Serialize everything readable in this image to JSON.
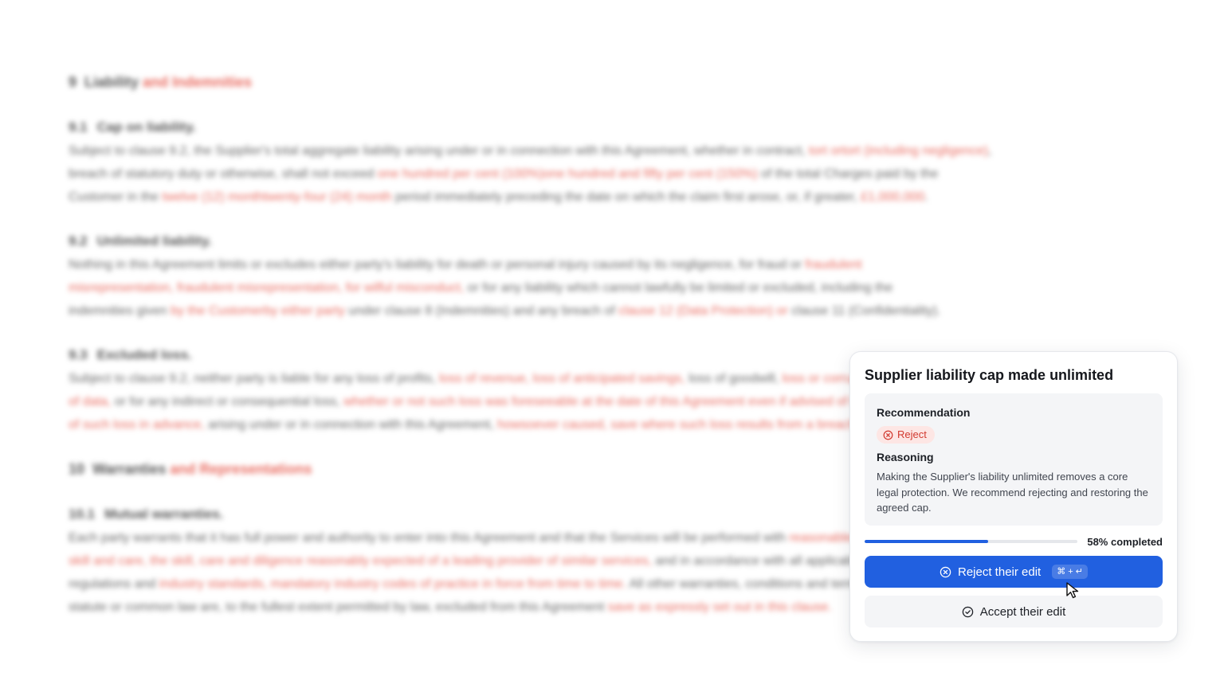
{
  "document": {
    "sections": [
      {
        "num": "9",
        "title": "Liability",
        "title_insert": "and Indemnities",
        "clauses": [
          {
            "num": "9.1",
            "title": "Cap on liability.",
            "lines": [
              [
                {
                  "t": "Subject to clause 9.2, the Supplier's total aggregate liability arising under or in connection with this Agreement, whether in contract, "
                },
                {
                  "t": "tort ortort (including negligence)",
                  "red": true
                },
                {
                  "t": ","
                }
              ],
              [
                {
                  "t": "breach of statutory duty or otherwise, shall not exceed "
                },
                {
                  "t": "one hundred per cent (100%)one hundred and fifty per cent (150%)",
                  "red": true
                },
                {
                  "t": " of the total Charges paid by the"
                }
              ],
              [
                {
                  "t": "Customer in the "
                },
                {
                  "t": "twelve (12) monthtwenty-four (24) month",
                  "red": true
                },
                {
                  "t": " period immediately preceding the date on which the claim first arose, or, if greater, "
                },
                {
                  "t": "£1,000,000",
                  "red": true
                },
                {
                  "t": "."
                }
              ]
            ]
          },
          {
            "num": "9.2",
            "title": "Unlimited liability.",
            "lines": [
              [
                {
                  "t": "Nothing in this Agreement limits or excludes either party's liability for death or personal injury caused by its negligence, for fraud or "
                },
                {
                  "t": "fraudulent",
                  "red": true
                }
              ],
              [
                {
                  "t": "misrepresentation, fraudulent misrepresentation, for wilful misconduct,",
                  "red": true
                },
                {
                  "t": " or for any liability which cannot lawfully be limited or excluded, including the"
                }
              ],
              [
                {
                  "t": "indemnities given "
                },
                {
                  "t": "by the Customerby either party",
                  "red": true
                },
                {
                  "t": " under clause 8 (Indemnities) and any breach of "
                },
                {
                  "t": "clause 12 (Data Protection) or",
                  "red": true
                },
                {
                  "t": " clause 11 (Confidentiality)."
                }
              ]
            ]
          },
          {
            "num": "9.3",
            "title": "Excluded loss.",
            "lines": [
              [
                {
                  "t": "Subject to clause 9.2, neither party is liable for any loss of profits, "
                },
                {
                  "t": "loss of revenue, loss of anticipated savings,",
                  "red": true
                },
                {
                  "t": " loss of goodwill, "
                },
                {
                  "t": "loss or corruption",
                  "red": true
                }
              ],
              [
                {
                  "t": "of data,",
                  "red": true
                },
                {
                  "t": " or for any indirect or consequential loss, "
                },
                {
                  "t": "whether or not such loss was foreseeable at the date of this Agreement even if advised of the possibility",
                  "red": true
                }
              ],
              [
                {
                  "t": "of such loss in advance,",
                  "red": true
                },
                {
                  "t": " arising under or in connection with this Agreement, "
                },
                {
                  "t": "howsoever caused, save where such loss results from a breach",
                  "red": true
                }
              ]
            ]
          }
        ]
      },
      {
        "num": "10",
        "title": "Warranties",
        "title_insert": "and Representations",
        "clauses": [
          {
            "num": "10.1",
            "title": "Mutual warranties.",
            "lines": [
              [
                {
                  "t": "Each party warrants that it has full power and authority to enter into this Agreement and that the Services will be performed with "
                },
                {
                  "t": "reasonable",
                  "red": true
                }
              ],
              [
                {
                  "t": "skill and care, the skill, care and diligence reasonably expected of a leading provider of similar services,",
                  "red": true
                },
                {
                  "t": " and in accordance with all applicable laws,"
                }
              ],
              [
                {
                  "t": "regulations and "
                },
                {
                  "t": "industry standards, mandatory industry codes of practice in force from time to time.",
                  "red": true
                },
                {
                  "t": " All other warranties, conditions and terms implied by"
                }
              ],
              [
                {
                  "t": "statute or common law are, to the fullest extent permitted by law, excluded from this Agreement "
                },
                {
                  "t": "save as expressly set out in this clause.",
                  "red": true
                }
              ]
            ]
          }
        ]
      }
    ]
  },
  "card": {
    "title": "Supplier liability cap made unlimited",
    "recommendation_label": "Recommendation",
    "recommendation_value": "Reject",
    "reasoning_label": "Reasoning",
    "reasoning_text": "Making the Supplier's liability unlimited removes a core legal protection. We recommend rejecting and restoring the agreed cap.",
    "progress_fraction": 0.58,
    "progress_text": "58% completed",
    "reject_label": "Reject their edit",
    "reject_shortcut": "⌘ + ↵",
    "accept_label": "Accept their edit",
    "colors": {
      "accent": "#2160e0",
      "danger": "#d2392f",
      "insertion": "#e96b60"
    }
  }
}
